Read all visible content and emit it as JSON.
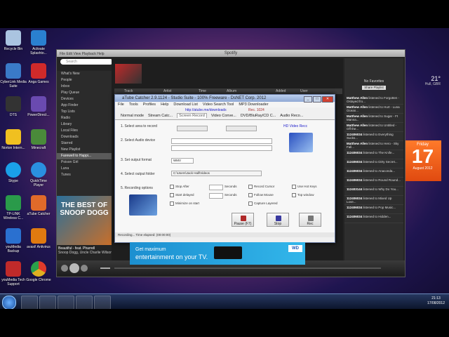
{
  "desktop_icons": [
    {
      "label": "Recycle Bin",
      "color": "#aac4e0"
    },
    {
      "label": "Activate Splashto...",
      "color": "#2a80d0"
    },
    {
      "label": "CyberLink Media Suite",
      "color": "#3a7ac8"
    },
    {
      "label": "Anga Games",
      "color": "#d02a2a"
    },
    {
      "label": "DTS",
      "color": "#333333"
    },
    {
      "label": "PowerDirect...",
      "color": "#6a4ab0"
    },
    {
      "label": "Norton Intern...",
      "color": "#f0c020"
    },
    {
      "label": "Minecraft",
      "color": "#4a8a3a"
    },
    {
      "label": "Skype",
      "color": "#1aa0e8"
    },
    {
      "label": "QuickTime Player",
      "color": "#2a90e0"
    },
    {
      "label": "TP-LINK Wireless C...",
      "color": "#2a9a4a"
    },
    {
      "label": "aTube Catcher",
      "color": "#e06a2a"
    },
    {
      "label": "youMedia Backup",
      "color": "#2a70d0"
    },
    {
      "label": "avast! Antivirus",
      "color": "#e07a10"
    },
    {
      "label": "youMedia Tech Support",
      "color": "#c02a2a"
    },
    {
      "label": "Google Chrome",
      "color": "#e0b020"
    },
    {
      "label": "Spotify",
      "color": "#2a2a2a"
    }
  ],
  "spotify": {
    "title": "Spotify",
    "menu": "File  Edit  View  Playback  Help",
    "search_placeholder": "Search",
    "sidebar": [
      "What's New",
      "People",
      "Inbox",
      "Play Queue",
      "Devices",
      "App Finder",
      "Top Lists",
      "Radio",
      "Library",
      "Local Files",
      "Downloads",
      "Starred",
      "New Playlist",
      "Farewell to Happi...",
      "Poison Girl",
      "Luna",
      "Tunes"
    ],
    "sidebar_selected": 13,
    "columns": [
      "Track",
      "Artist",
      "Time",
      "Album",
      "Added",
      "User"
    ],
    "user": "Log out",
    "now_playing": "Beautiful - feat. Pharrell",
    "now_playing_artist": "Snoop Dogg, Uncle Charlie Wilson",
    "album_text": "THE BEST OF SNOOP DOGG",
    "right_header": "No Favorites",
    "right_button": "Share Playlist",
    "feed": [
      {
        "who": "Matthew Allen",
        "what": "listened to Forgotten - Ostayed fro..."
      },
      {
        "who": "Matthew Allen",
        "what": "listened to Hurt - Luna Ocean..."
      },
      {
        "who": "Matthew Allen",
        "what": "listened to Sugar - Ft Manna..."
      },
      {
        "who": "Matthew Allen",
        "what": "listened to Untitled - Off the..."
      },
      {
        "who": "112406034",
        "what": "listened to Everything Sucks..."
      },
      {
        "who": "Matthew Allen",
        "what": "listened to Hero - Sky Fall..."
      },
      {
        "who": "112406034",
        "what": "listened to The Knife..."
      },
      {
        "who": "112406034",
        "what": "listened to Dirty Secret..."
      },
      {
        "who": "112406034",
        "what": "listened to Anaconda..."
      },
      {
        "who": "112406034",
        "what": "listened to Round Round..."
      },
      {
        "who": "112403144",
        "what": "listened to Why Do You..."
      },
      {
        "who": "112406034",
        "what": "listened to Mixed Up Love..."
      },
      {
        "who": "112406034",
        "what": "listened to Pop Music..."
      },
      {
        "who": "112406034",
        "what": "listened to Hidden..."
      }
    ]
  },
  "atube": {
    "title": "aTube Catcher 2.9.1124 - Studio Suite - 100% Freeware - DsNET Corp. 2012",
    "menu": [
      "File",
      "Tools",
      "Profiles",
      "Help",
      "Download List",
      "Video Search Tool",
      "MP3 Downloader"
    ],
    "url": "http://atube.me/downloads",
    "rec_label": "Rec. 1024",
    "tabs": [
      "Normal mode",
      "Stream Catc...",
      "Screen Record",
      "Video Conve...",
      "DVD/BluRay/CD C...",
      "Audio Reco..."
    ],
    "active_tab": 2,
    "steps": [
      "1. Select area to record",
      "2. Select Audio device",
      "3. Set output format",
      "4. Select output folder",
      "5. Recording options"
    ],
    "hd_label": "HD Video Recc",
    "format_value": "WMV",
    "folder_value": "C:\\Users\\Jack Hall\\Videos",
    "options": [
      "Stop After",
      "Start delayed",
      "Minimize on start",
      "Record Cursor",
      "Follow Mouse",
      "Capture Layered",
      "Use Hot Keys",
      "Top window"
    ],
    "seconds": "Seconds",
    "buttons": [
      "Pause (F7)",
      "Stop",
      "Rec"
    ],
    "status": "Recording... Time elapsed: (00:00:00)"
  },
  "ad": {
    "line1": "Get maximum",
    "line2": "entertainment on your TV.",
    "brand": "WD"
  },
  "calendar": {
    "day": "Friday",
    "date": "17",
    "month": "August 2012"
  },
  "weather": {
    "temp": "21°",
    "place": "Hull, GBR"
  },
  "tray": {
    "time": "21:13",
    "date": "17/08/2012"
  }
}
